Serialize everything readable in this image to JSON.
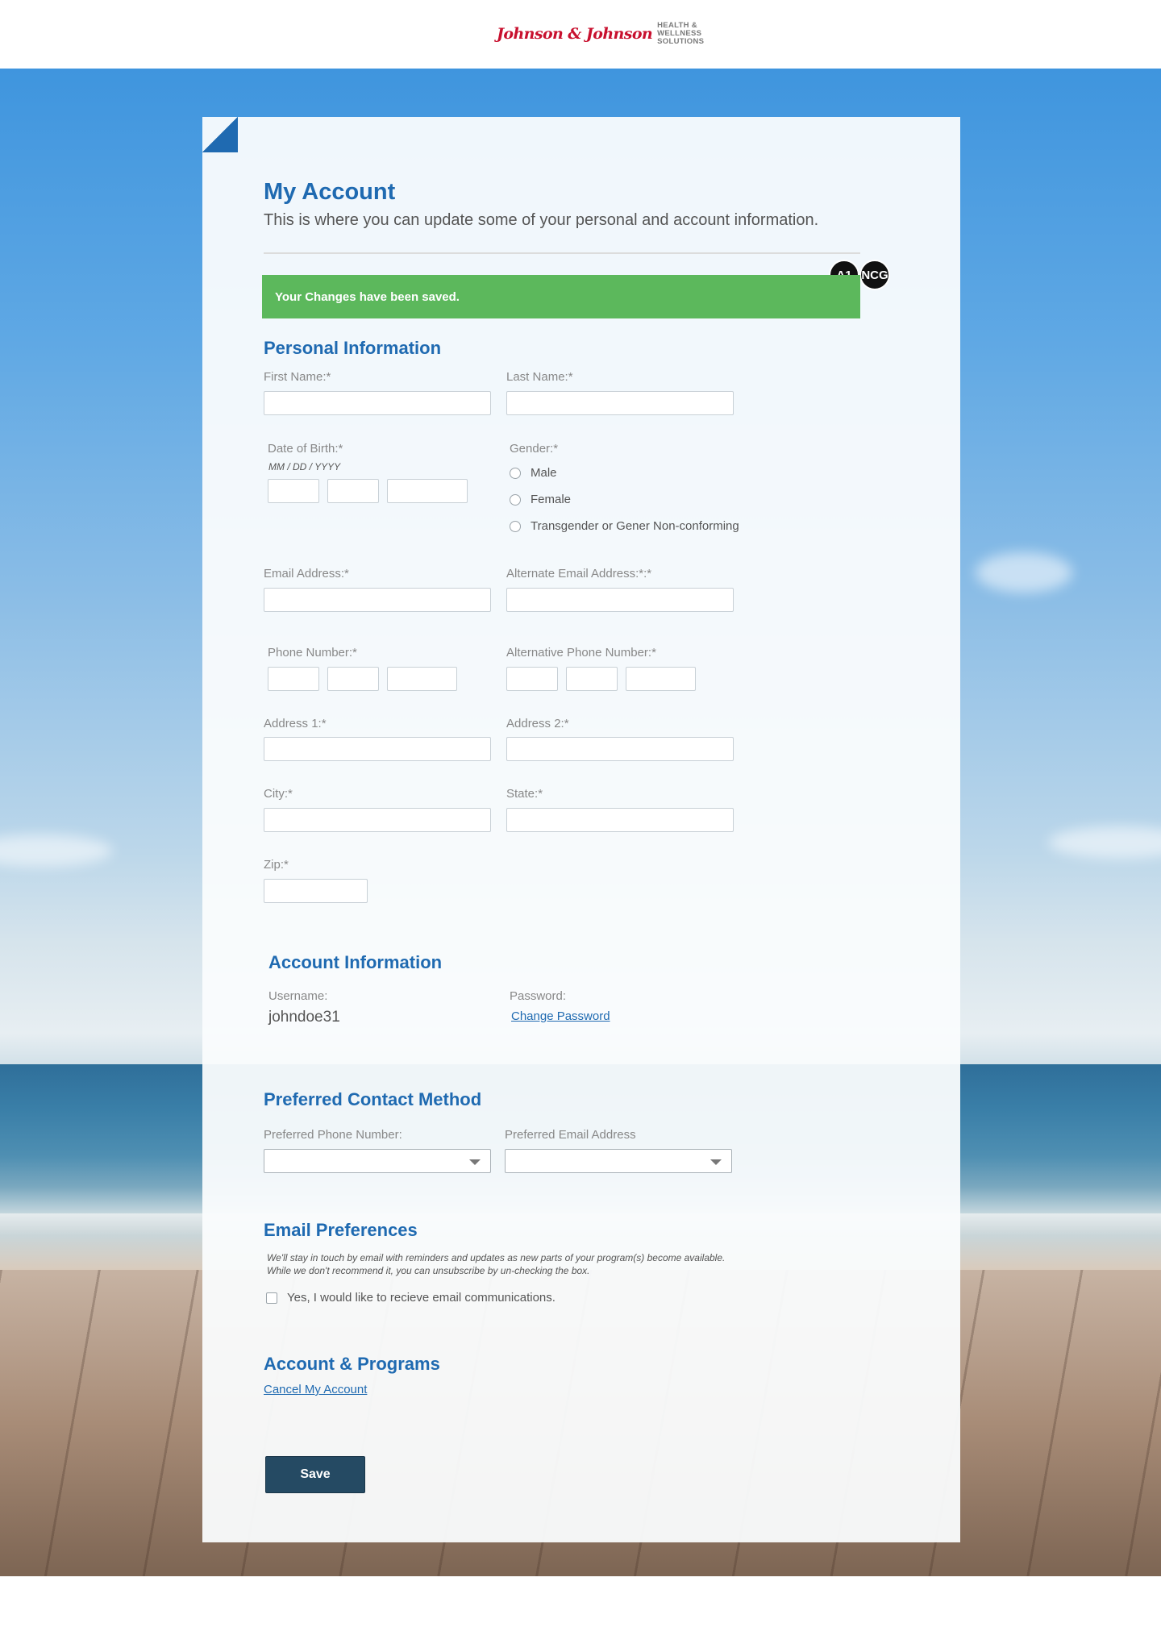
{
  "header": {
    "logo_script": "Johnson & Johnson",
    "logo_tagline": [
      "HEALTH &",
      "WELLNESS",
      "SOLUTIONS"
    ]
  },
  "page": {
    "title": "My Account",
    "subtitle": "This is where you can update some of your personal and account information."
  },
  "badges": [
    "A1",
    "NCG"
  ],
  "alert": {
    "text": "Your Changes have been saved.",
    "color": "#5cb85c"
  },
  "personal": {
    "heading": "Personal Information",
    "first_name_label": "First Name:*",
    "last_name_label": "Last Name:*",
    "dob_label": "Date of Birth:*",
    "dob_format": "MM / DD / YYYY",
    "gender_label": "Gender:*",
    "gender_options": [
      "Male",
      "Female",
      "Transgender or Gener Non-conforming"
    ],
    "email_label": "Email Address:*",
    "alt_email_label": "Alternate Email Address:*:*",
    "phone_label": "Phone Number:*",
    "alt_phone_label": "Alternative Phone Number:*",
    "address1_label": "Address 1:*",
    "address2_label": "Address 2:*",
    "city_label": "City:*",
    "state_label": "State:*",
    "zip_label": "Zip:*"
  },
  "account": {
    "heading": "Account Information",
    "username_label": "Username:",
    "username_value": "johndoe31",
    "password_label": "Password:",
    "change_password": "Change Password"
  },
  "contact": {
    "heading": "Preferred Contact Method",
    "phone_label": "Preferred Phone Number:",
    "email_label": "Preferred Email Address"
  },
  "email_prefs": {
    "heading": "Email Preferences",
    "note_line1": "We'll stay in touch by email with reminders and updates as new parts of your program(s) become available.",
    "note_line2": "While we don't recommend it, you can unsubscribe by un-checking the box.",
    "checkbox_label": "Yes, I would like to recieve email communications."
  },
  "programs": {
    "heading": "Account & Programs",
    "cancel_link": "Cancel My Account"
  },
  "actions": {
    "save_label": "Save"
  },
  "colors": {
    "brand_blue": "#1f6ab1",
    "logo_red": "#c8102e",
    "save_button": "#254a63"
  }
}
